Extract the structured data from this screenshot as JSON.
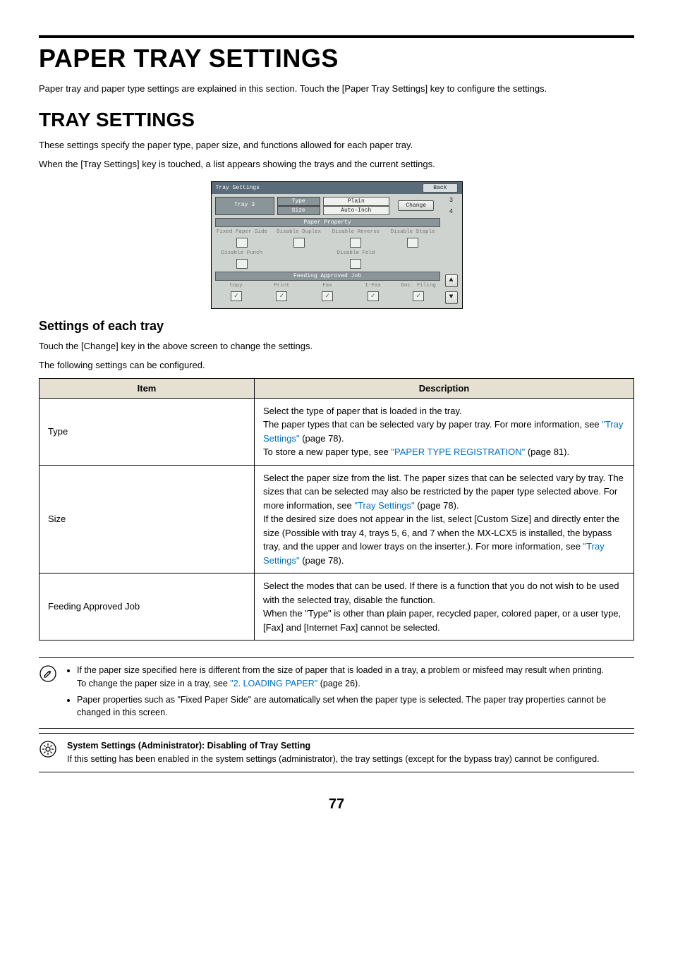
{
  "heading1": "PAPER TRAY SETTINGS",
  "intro": "Paper tray and paper type settings are explained in this section. Touch the [Paper Tray Settings] key to configure the settings.",
  "heading2": "TRAY SETTINGS",
  "sub_intro1": "These settings specify the paper type, paper size, and functions allowed for each paper tray.",
  "sub_intro2": "When the [Tray Settings] key is touched, a list appears showing the trays and the current settings.",
  "lcd": {
    "title": "Tray Settings",
    "back": "Back",
    "tray_label": "Tray 3",
    "type_label": "Type",
    "size_label": "Size",
    "type_value": "Plain",
    "size_value": "Auto-Inch",
    "change": "Change",
    "paper_property": "Paper Property",
    "props": [
      "Fixed Paper Side",
      "Disable Duplex",
      "Disable Reverse",
      "Disable Staple"
    ],
    "props2_left": "Disable Punch",
    "props2_right": "Disable Fold",
    "feeding": "Feeding Approved Job",
    "jobs": [
      "Copy",
      "Print",
      "Fax",
      "I-Fax",
      "Doc. Filing"
    ],
    "side_numbers": [
      "3",
      "4"
    ]
  },
  "heading3": "Settings of each tray",
  "settings_intro1": "Touch the [Change] key in the above screen to change the settings.",
  "settings_intro2": "The following settings can be configured.",
  "table": {
    "head_item": "Item",
    "head_desc": "Description",
    "rows": [
      {
        "item": "Type",
        "desc_pre": "Select the type of paper that is loaded in the tray.\nThe paper types that can be selected vary by paper tray. For more information, see ",
        "link1": "\"Tray Settings\"",
        "desc_mid": " (page 78).\nTo store a new paper type, see ",
        "link2": "\"PAPER TYPE REGISTRATION\"",
        "desc_post": " (page 81)."
      },
      {
        "item": "Size",
        "desc_pre": "Select the paper size from the list. The paper sizes that can be selected vary by tray. The sizes that can be selected may also be restricted by the paper type selected above. For more information, see ",
        "link1": "\"Tray Settings\"",
        "desc_mid": " (page 78).\nIf the desired size does not appear in the list, select [Custom Size] and directly enter the size (Possible with tray 4, trays 5, 6, and 7 when the MX-LCX5 is installed, the bypass tray, and the upper and lower trays on the inserter.). For more information, see ",
        "link2": "\"Tray Settings\"",
        "desc_post": " (page 78)."
      },
      {
        "item": "Feeding Approved Job",
        "desc_plain": "Select the modes that can be used. If there is a function that you do not wish to be used with the selected tray, disable the function.\nWhen the \"Type\" is other than plain paper, recycled paper, colored paper, or a user type, [Fax] and [Internet Fax] cannot be selected."
      }
    ]
  },
  "note1": {
    "b1_pre": "If the paper size specified here is different from the size of paper that is loaded in a tray, a problem or misfeed may result when printing.",
    "b1_sub_pre": "To change the paper size in a tray, see ",
    "b1_sub_link": "\"2. LOADING PAPER\"",
    "b1_sub_post": " (page 26).",
    "b2": "Paper properties such as \"Fixed Paper Side\" are automatically set when the paper type is selected. The paper tray properties cannot be changed in this screen."
  },
  "note2": {
    "title": "System Settings (Administrator): Disabling of Tray Setting",
    "body": "If this setting has been enabled in the system settings (administrator), the tray settings (except for the bypass tray) cannot be configured."
  },
  "page_number": "77"
}
